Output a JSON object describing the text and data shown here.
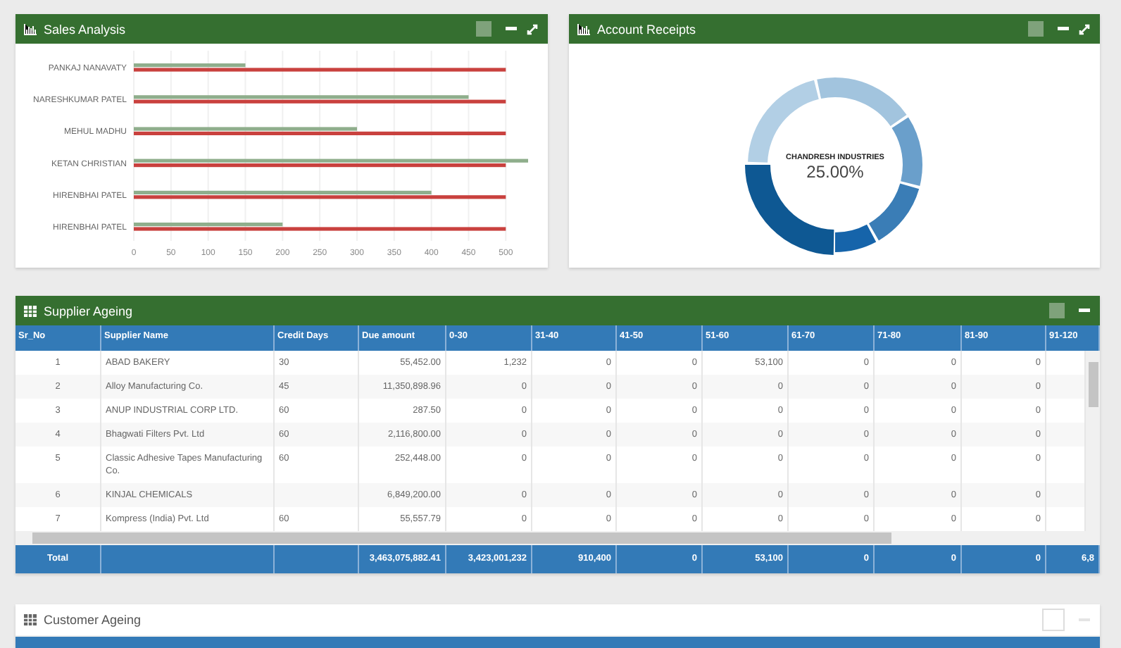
{
  "sales_analysis": {
    "title": "Sales Analysis",
    "chart_data": {
      "type": "bar",
      "orientation": "horizontal",
      "categories": [
        "PANKAJ NANAVATY",
        "NARESHKUMAR PATEL",
        "MEHUL MADHU",
        "KETAN CHRISTIAN",
        "HIRENBHAI PATEL",
        "HIRENBHAI PATEL"
      ],
      "series": [
        {
          "color": "#8fae8c",
          "values": [
            150,
            450,
            300,
            530,
            400,
            200
          ]
        },
        {
          "color": "#c9413e",
          "values": [
            500,
            500,
            500,
            500,
            500,
            500
          ]
        }
      ],
      "xlim": [
        0,
        530
      ],
      "grid": true,
      "xticks": [
        0,
        50,
        100,
        150,
        200,
        250,
        300,
        350,
        400,
        450,
        500
      ]
    }
  },
  "account_receipts": {
    "title": "Account Receipts",
    "center_label": "CHANDRESH INDUSTRIES",
    "center_value": "25.00%"
  },
  "supplier_ageing": {
    "title": "Supplier Ageing",
    "columns": [
      "Sr_No",
      "Supplier Name",
      "Credit Days",
      "Due amount",
      "0-30",
      "31-40",
      "41-50",
      "51-60",
      "61-70",
      "71-80",
      "81-90",
      "91-120"
    ],
    "rows": [
      [
        "1",
        "ABAD BAKERY",
        "30",
        "55,452.00",
        "1,232",
        "0",
        "0",
        "53,100",
        "0",
        "0",
        "0"
      ],
      [
        "2",
        "Alloy Manufacturing Co.",
        "45",
        "11,350,898.96",
        "0",
        "0",
        "0",
        "0",
        "0",
        "0",
        "0"
      ],
      [
        "3",
        "ANUP INDUSTRIAL CORP LTD.",
        "60",
        "287.50",
        "0",
        "0",
        "0",
        "0",
        "0",
        "0",
        "0"
      ],
      [
        "4",
        "Bhagwati Filters Pvt. Ltd",
        "60",
        "2,116,800.00",
        "0",
        "0",
        "0",
        "0",
        "0",
        "0",
        "0"
      ],
      [
        "5",
        "Classic Adhesive Tapes Manufacturing Co.",
        "60",
        "252,448.00",
        "0",
        "0",
        "0",
        "0",
        "0",
        "0",
        "0"
      ],
      [
        "6",
        "KINJAL CHEMICALS",
        "",
        "6,849,200.00",
        "0",
        "0",
        "0",
        "0",
        "0",
        "0",
        "0"
      ],
      [
        "7",
        "Kompress (India) Pvt. Ltd",
        "60",
        "55,557.79",
        "0",
        "0",
        "0",
        "0",
        "0",
        "0",
        "0"
      ]
    ],
    "total": {
      "label": "Total",
      "values": [
        "3,463,075,882.41",
        "3,423,001,232",
        "910,400",
        "0",
        "53,100",
        "0",
        "0",
        "0",
        "6,8"
      ]
    }
  },
  "customer_ageing": {
    "title": "Customer Ageing"
  }
}
